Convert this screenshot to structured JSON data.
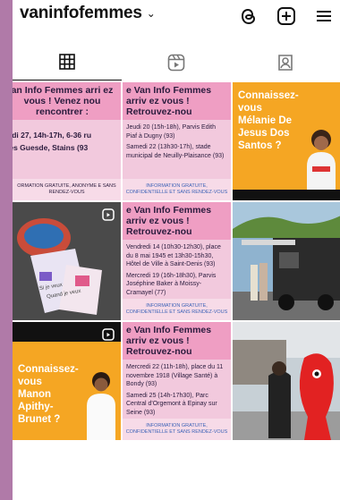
{
  "header": {
    "username": "vaninfofemmes",
    "caret": "⌄"
  },
  "tabs": [
    {
      "name": "grid",
      "active": true
    },
    {
      "name": "reels",
      "active": false
    },
    {
      "name": "tagged",
      "active": false
    }
  ],
  "posts": {
    "p1": {
      "head": "an Info Femmes arri ez vous ! Venez nou rencontrer :",
      "line1": "udi 27, 14h-17h, 6-36 ru",
      "line2": "les Guesde, Stains (93",
      "foot": "ORMATION GRATUITE, ANONYME E SANS RENDEZ-VOUS"
    },
    "p2": {
      "head": "e Van Info Femmes arriv ez vous ! Retrouvez-nou",
      "body1": "Jeudi 20 (15h-18h), Parvis Edith Piaf à Dugny (93)",
      "body2": "Samedi 22 (13h30-17h), stade municipal de Neuilly-Plaisance (93)",
      "foot": "INFORMATION GRATUITE, CONFIDENTIELLE ET SANS RENDEZ-VOUS"
    },
    "p3": {
      "title": "Connaissez-vous Mélanie De Jesus Dos Santos ?"
    },
    "p4": {
      "card1": "Si je veux",
      "card2": "Quand je veux"
    },
    "p5": {
      "head": "e Van Info Femmes arriv ez vous ! Retrouvez-nou",
      "body1": "Vendredi 14 (10h30-12h30), place du 8 mai 1945 et 13h30-15h30, Hôtel de Ville à Saint-Denis (93)",
      "body2": "Mercredi 19 (16h-18h30), Parvis Joséphine Baker à Moissy-Cramayel (77)",
      "foot": "INFORMATION GRATUITE, CONFIDENTIELLE ET SANS RENDEZ-VOUS"
    },
    "p6": {},
    "p7": {
      "title": "Connaissez-vous Manon Apithy-Brunet ?"
    },
    "p8": {
      "head": "e Van Info Femmes arriv ez vous ! Retrouvez-nou",
      "body1": "Mercredi 22 (11h-18h), place du 11 novembre 1918 (Village Santé) à Bondy (93)",
      "body2": "Samedi 25 (14h-17h30), Parc Central d'Orgemont à Epinay sur Seine (93)",
      "foot": "INFORMATION GRATUITE, CONFIDENTIELLE ET SANS RENDEZ-VOUS"
    },
    "p9": {}
  },
  "colors": {
    "accent_frame": "#b07aa8",
    "pink_bg": "#f2c9dd",
    "pink_head": "#ef9ec3",
    "orange": "#f5a623"
  }
}
